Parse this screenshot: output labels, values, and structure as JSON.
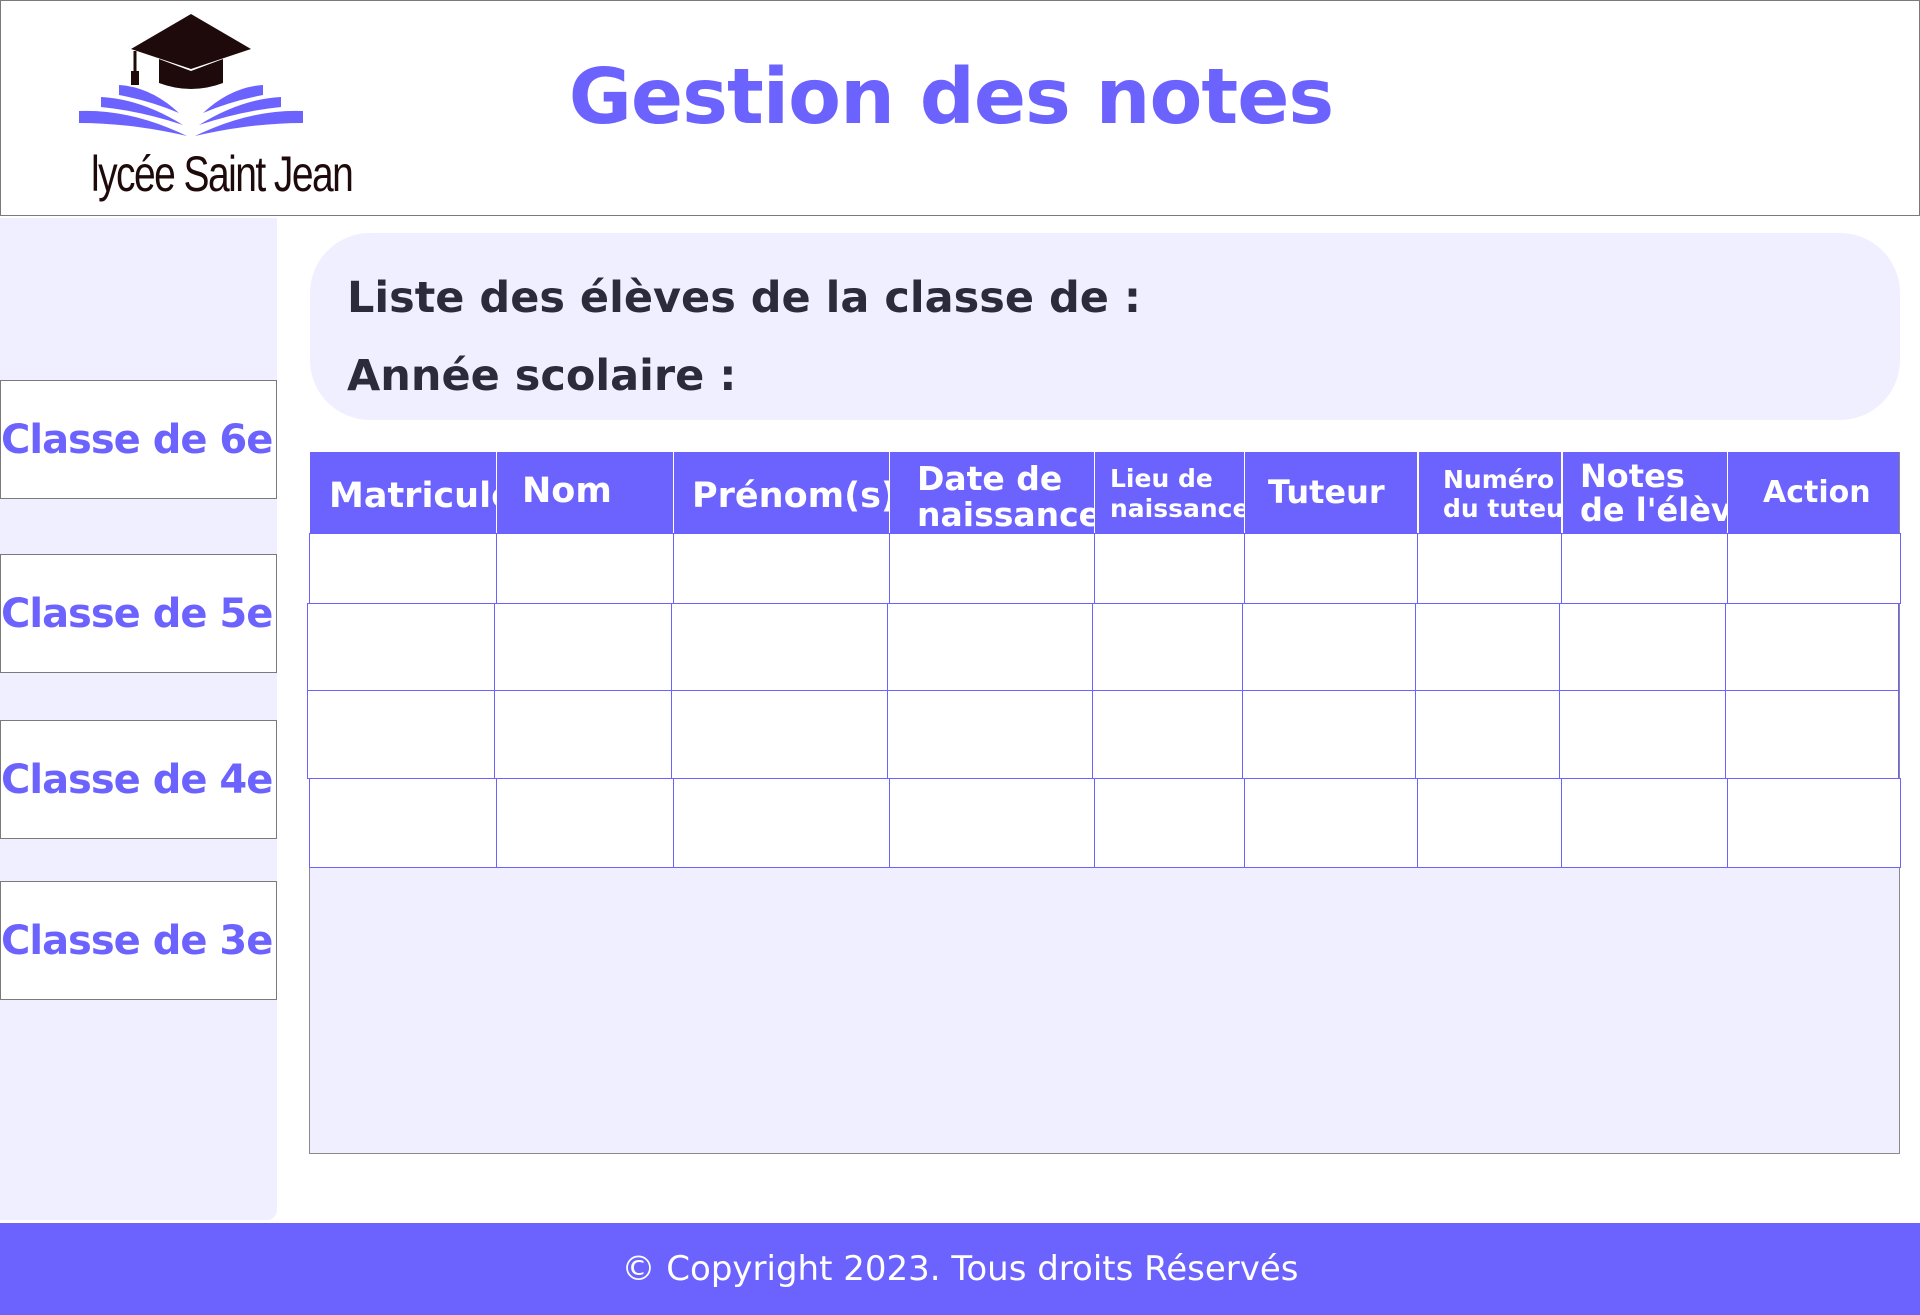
{
  "header": {
    "logo_text": "lycée Saint Jean",
    "title": "Gestion des notes"
  },
  "sidebar": {
    "items": [
      {
        "label": "Classe de 6e"
      },
      {
        "label": "Classe de 5e"
      },
      {
        "label": "Classe de 4e"
      },
      {
        "label": "Classe de 3e"
      }
    ]
  },
  "info": {
    "class_label": "Liste des élèves de la classe de :",
    "year_label": "Année scolaire :"
  },
  "table": {
    "columns": [
      {
        "line1": "Matricule",
        "line2": ""
      },
      {
        "line1": "Nom",
        "line2": ""
      },
      {
        "line1": "Prénom(s)",
        "line2": ""
      },
      {
        "line1": "Date de",
        "line2": "naissance"
      },
      {
        "line1": "Lieu de",
        "line2": "naissance"
      },
      {
        "line1": "Tuteur",
        "line2": ""
      },
      {
        "line1": "Numéro",
        "line2": "du tuteur"
      },
      {
        "line1": "Notes",
        "line2": "de l'élève"
      },
      {
        "line1": "Action",
        "line2": ""
      }
    ],
    "rows": [
      [
        "",
        "",
        "",
        "",
        "",
        "",
        "",
        "",
        ""
      ],
      [
        "",
        "",
        "",
        "",
        "",
        "",
        "",
        "",
        ""
      ],
      [
        "",
        "",
        "",
        "",
        "",
        "",
        "",
        "",
        ""
      ],
      [
        "",
        "",
        "",
        "",
        "",
        "",
        "",
        "",
        ""
      ]
    ]
  },
  "footer": {
    "copyright": "© Copyright 2023. Tous droits Réservés"
  },
  "colors": {
    "accent": "#6c63ff",
    "panel": "#f0efff",
    "text_dark": "#2b2b3c"
  }
}
